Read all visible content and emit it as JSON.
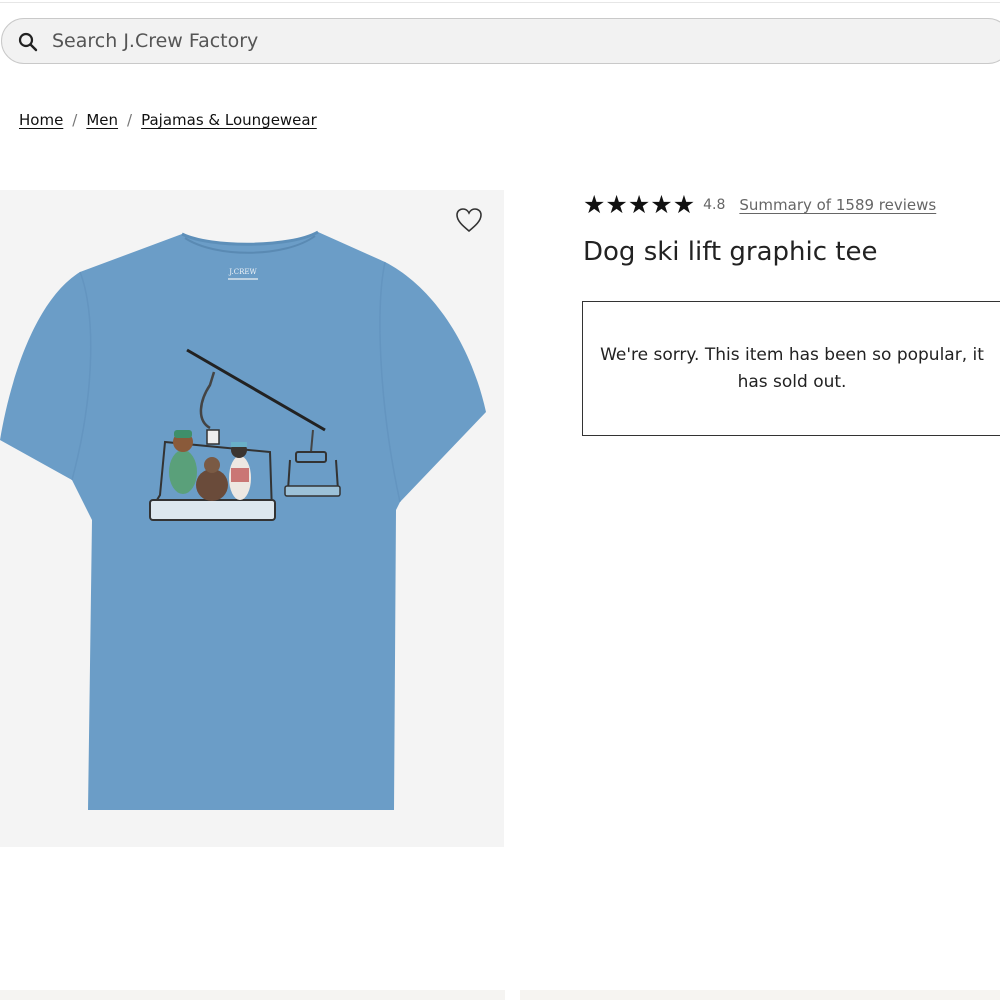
{
  "search": {
    "placeholder": "Search J.Crew Factory",
    "icon": "search-icon"
  },
  "breadcrumb": {
    "items": [
      "Home",
      "Men",
      "Pajamas & Loungewear"
    ],
    "separator": "/"
  },
  "product": {
    "image": {
      "brand_label": "J.CREW",
      "shirt_color": "#6b9dc7"
    },
    "wishlist_icon": "heart-outline-icon",
    "rating": {
      "value": "4.8",
      "stars": 5,
      "reviews_link": "Summary of 1589 reviews"
    },
    "title": "Dog ski lift graphic tee",
    "sold_out_message": "We're sorry. This item has been so popular, it has sold out."
  },
  "colors": {
    "text": "#222222",
    "muted": "#666666",
    "search_bg": "#f2f2f2",
    "image_bg": "#f4f4f4"
  }
}
